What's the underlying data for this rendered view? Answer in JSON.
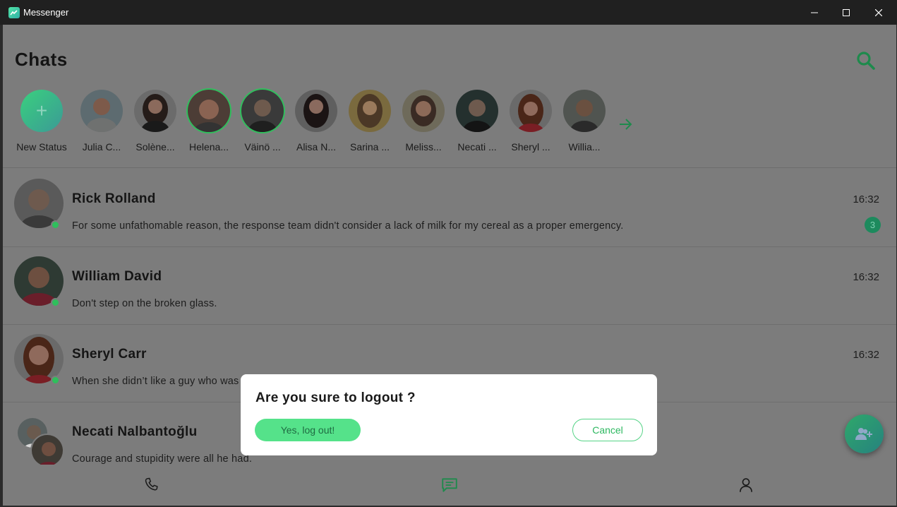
{
  "window": {
    "title": "Messenger",
    "controls": [
      "minimize-icon",
      "maximize-icon",
      "close-icon"
    ]
  },
  "header": {
    "title": "Chats",
    "search_icon": "search-icon"
  },
  "stories": {
    "new_status_label": "New Status",
    "items": [
      {
        "label": "Julia C...",
        "ring": false
      },
      {
        "label": "Solène...",
        "ring": false
      },
      {
        "label": "Helena...",
        "ring": true
      },
      {
        "label": "Väinö ...",
        "ring": true
      },
      {
        "label": "Alisa N...",
        "ring": false
      },
      {
        "label": "Sarina ...",
        "ring": false
      },
      {
        "label": "Meliss...",
        "ring": false
      },
      {
        "label": "Necati ...",
        "ring": false
      },
      {
        "label": "Sheryl ...",
        "ring": false
      },
      {
        "label": "Willia...",
        "ring": false
      }
    ],
    "next_icon": "arrow-right-icon"
  },
  "chats": [
    {
      "name": "Rick Rolland",
      "time": "16:32",
      "message": "For some unfathomable reason, the response team didn't consider a lack of milk for my cereal as a proper emergency.",
      "unread": "3",
      "online": true
    },
    {
      "name": "William David",
      "time": "16:32",
      "message": "Don't step on the broken glass.",
      "online": true
    },
    {
      "name": "Sheryl Carr",
      "time": "16:32",
      "message": "When she didn’t like a guy who was trying to pick her up, she started using sign language.",
      "online": true
    },
    {
      "name": "Necati Nalbantoğlu",
      "time": "",
      "message": "Courage and stupidity were all he had.",
      "group": true
    }
  ],
  "bottom_nav": {
    "items": [
      "phone-icon",
      "chat-icon",
      "profile-icon"
    ],
    "active": "chat-icon"
  },
  "fab": {
    "icon": "add-user-icon"
  },
  "dialog": {
    "title": "Are you sure to logout ?",
    "confirm_label": "Yes, log out!",
    "cancel_label": "Cancel"
  },
  "colors": {
    "accent": "#55e28a",
    "accent_dark": "#2fbf5c",
    "overlay_bg": "#7c7c7c",
    "titlebar": "#202020"
  }
}
